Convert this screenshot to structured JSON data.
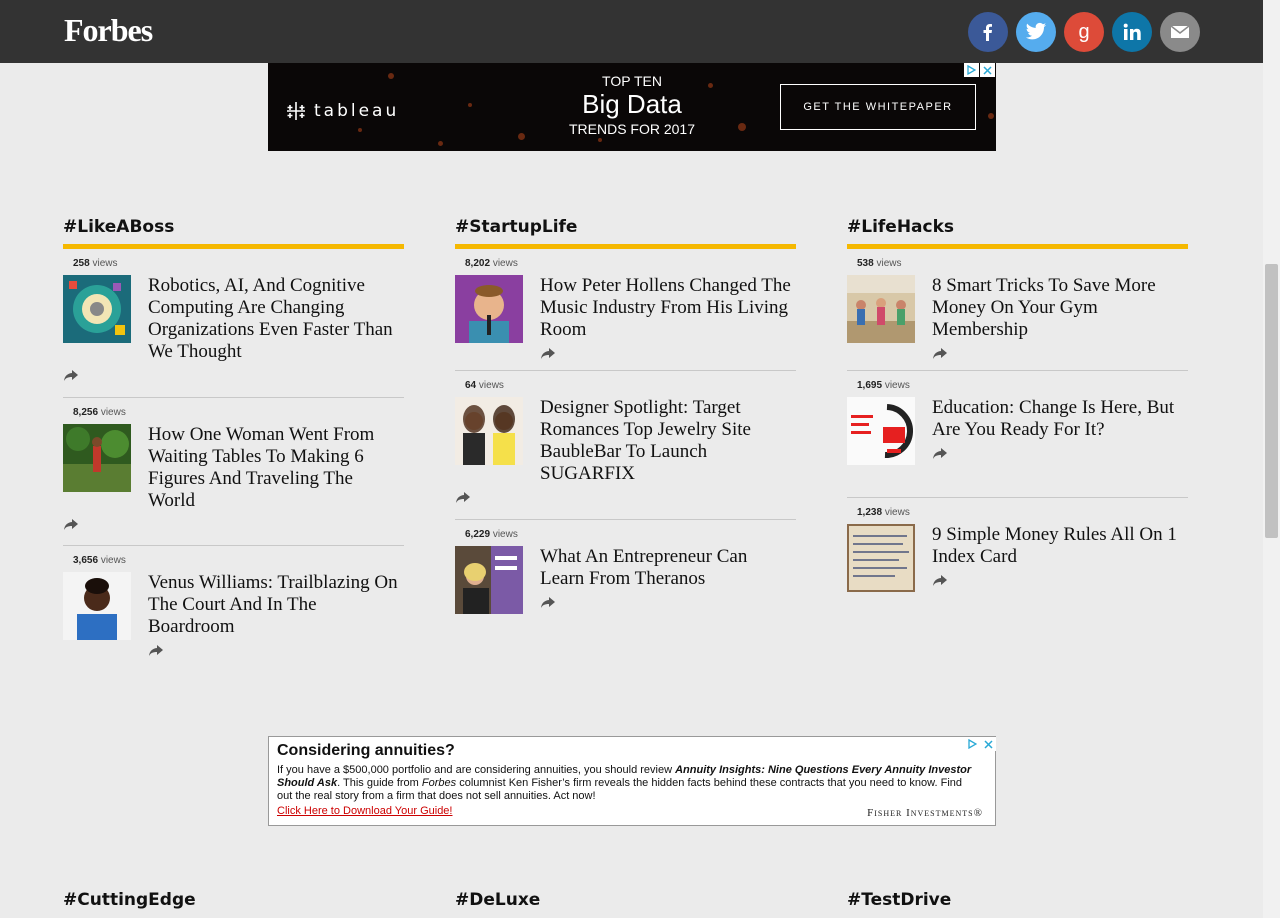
{
  "header": {
    "logo": "Forbes"
  },
  "social": [
    {
      "name": "facebook",
      "icon": "facebook-icon",
      "color": "#3b5998"
    },
    {
      "name": "twitter",
      "icon": "twitter-icon",
      "color": "#55acee"
    },
    {
      "name": "googleplus",
      "icon": "google-plus-icon",
      "color": "#dd4b39"
    },
    {
      "name": "linkedin",
      "icon": "linkedin-icon",
      "color": "#0e76a8"
    },
    {
      "name": "email",
      "icon": "email-icon",
      "color": "#8a8a8a"
    }
  ],
  "ad_top": {
    "brand": "tableau",
    "line1": "TOP TEN",
    "line2": "Big Data",
    "line3": "TRENDS FOR 2017",
    "cta": "GET THE WHITEPAPER"
  },
  "sections": [
    {
      "title": "#LikeABoss",
      "items": [
        {
          "views": "258",
          "views_label": "views",
          "headline": "Robotics, AI, And Cognitive Computing Are Changing Organizations Even Faster Than We Thought"
        },
        {
          "views": "8,256",
          "views_label": "views",
          "headline": "How One Woman Went From Waiting Tables To Making 6 Figures And Traveling The World"
        },
        {
          "views": "3,656",
          "views_label": "views",
          "headline": "Venus Williams: Trailblazing On The Court And In The Boardroom"
        }
      ]
    },
    {
      "title": "#StartupLife",
      "items": [
        {
          "views": "8,202",
          "views_label": "views",
          "headline": "How Peter Hollens Changed The Music Industry From His Living Room"
        },
        {
          "views": "64",
          "views_label": "views",
          "headline": "Designer Spotlight: Target Romances Top Jewelry Site BaubleBar To Launch SUGARFIX"
        },
        {
          "views": "6,229",
          "views_label": "views",
          "headline": "What An Entrepreneur Can Learn From Theranos"
        }
      ]
    },
    {
      "title": "#LifeHacks",
      "items": [
        {
          "views": "538",
          "views_label": "views",
          "headline": "8 Smart Tricks To Save More Money On Your Gym Membership"
        },
        {
          "views": "1,695",
          "views_label": "views",
          "headline": "Education: Change Is Here, But Are You Ready For It?"
        },
        {
          "views": "1,238",
          "views_label": "views",
          "headline": "9 Simple Money Rules All On 1 Index Card"
        }
      ]
    }
  ],
  "ad_bottom": {
    "title": "Considering annuities?",
    "body_1": "If you have a $500,000 portfolio and are considering annuities, you should review ",
    "body_2": "Annuity Insights: Nine Questions Every Annuity Investor Should Ask",
    "body_3": ". This guide from ",
    "body_4": "Forbes",
    "body_5": " columnist Ken Fisher’s firm reveals the hidden facts behind these contracts that you need to know. Find out the real story from a firm that does not sell annuities. Act now!",
    "link": "Click Here to Download Your Guide!",
    "brand": "Fisher Investments®"
  },
  "next_sections": [
    "#CuttingEdge",
    "#DeLuxe",
    "#TestDrive"
  ],
  "colors": {
    "accent": "#f5b800",
    "header_bg": "#333333",
    "page_bg": "#ebebeb"
  }
}
